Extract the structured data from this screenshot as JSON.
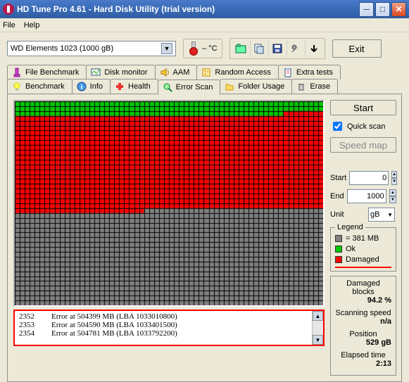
{
  "window": {
    "title": "HD Tune Pro 4.61 - Hard Disk Utility (trial version)"
  },
  "menu": {
    "file": "File",
    "help": "Help"
  },
  "toolbar": {
    "drive": "WD    Elements 1023   (1000 gB)",
    "temp": "– °C",
    "exit": "Exit"
  },
  "tabs": {
    "file_benchmark": "File Benchmark",
    "disk_monitor": "Disk monitor",
    "aam": "AAM",
    "random_access": "Random Access",
    "extra_tests": "Extra tests",
    "benchmark": "Benchmark",
    "info": "Info",
    "health": "Health",
    "error_scan": "Error Scan",
    "folder_usage": "Folder Usage",
    "erase": "Erase"
  },
  "side": {
    "start": "Start",
    "quick_scan": "Quick scan",
    "speed_map": "Speed map",
    "start_lbl": "Start",
    "start_val": "0",
    "end_lbl": "End",
    "end_val": "1000",
    "unit_lbl": "Unit",
    "unit_val": "gB"
  },
  "legend": {
    "title": "Legend",
    "block": "= 381 MB",
    "ok": "Ok",
    "damaged": "Damaged"
  },
  "stats": {
    "damaged_lbl": "Damaged blocks",
    "damaged_val": "94.2 %",
    "speed_lbl": "Scanning speed",
    "speed_val": "n/a",
    "position_lbl": "Position",
    "position_val": "529 gB",
    "elapsed_lbl": "Elapsed time",
    "elapsed_val": "2:13"
  },
  "log": {
    "rows": [
      {
        "n": "2352",
        "msg": "Error at 504399 MB (LBA 1033010800)"
      },
      {
        "n": "2353",
        "msg": "Error at 504590 MB (LBA 1033401500)"
      },
      {
        "n": "2354",
        "msg": "Error at 504781 MB (LBA 1033792200)"
      }
    ]
  },
  "chart_data": {
    "type": "heatmap",
    "title": "Error Scan Block Map",
    "cols": 62,
    "rows": 42,
    "cell_states": {
      "ok": "green",
      "damaged": "red",
      "pending": "gray"
    },
    "row_state_ranges": [
      {
        "rows": [
          0,
          1
        ],
        "state": "ok"
      },
      {
        "row": 2,
        "ok_cols": [
          0,
          53
        ],
        "damaged_cols": [
          54,
          61
        ]
      },
      {
        "rows": [
          3,
          21
        ],
        "state": "damaged"
      },
      {
        "row": 22,
        "damaged_cols": [
          0,
          25
        ],
        "pending_cols": [
          26,
          61
        ]
      },
      {
        "rows": [
          23,
          41
        ],
        "state": "pending"
      }
    ],
    "legend": {
      "ok": "Ok",
      "damaged": "Damaged",
      "block_size": "381 MB"
    }
  }
}
